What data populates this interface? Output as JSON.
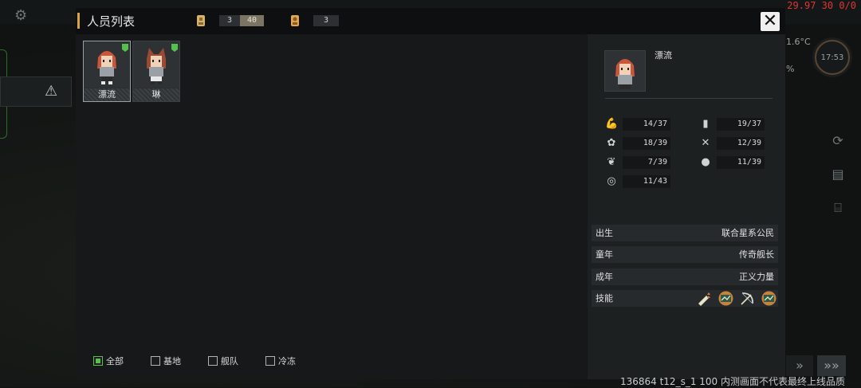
{
  "background": {
    "top_right_stats": "29.97 30 0/0",
    "temperature": "1.6°C",
    "percent_fragment": "%",
    "clock": "17:53",
    "footer_text": "136864 t12_s_1 100 内测画面不代表最终上线品质"
  },
  "dialog": {
    "title": "人员列表",
    "resources": [
      {
        "icon": "crew-capacity-icon",
        "current": "3",
        "max": "40"
      },
      {
        "icon": "crew-count-icon",
        "value": "3"
      }
    ],
    "close_label": "✕"
  },
  "crew_list": [
    {
      "name": "漂流",
      "selected": true
    },
    {
      "name": "琳",
      "selected": false
    }
  ],
  "filters": [
    {
      "label": "全部",
      "checked": true
    },
    {
      "label": "基地",
      "checked": false
    },
    {
      "label": "舰队",
      "checked": false
    },
    {
      "label": "冷冻",
      "checked": false
    }
  ],
  "detail": {
    "name": "漂流",
    "stats": [
      {
        "icon": "strength-arm-icon",
        "value": "14/37"
      },
      {
        "icon": "document-icon",
        "value": "19/37"
      },
      {
        "icon": "paw-icon",
        "value": "18/39"
      },
      {
        "icon": "tools-icon",
        "value": "12/39"
      },
      {
        "icon": "leaf-icon",
        "value": "7/39"
      },
      {
        "icon": "chat-icon",
        "value": "11/39"
      },
      {
        "icon": "target-icon",
        "value": "11/43"
      }
    ],
    "info": [
      {
        "label": "出生",
        "value": "联合星系公民"
      },
      {
        "label": "童年",
        "value": "传奇舰长"
      },
      {
        "label": "成年",
        "value": "正义力量"
      }
    ],
    "skills_label": "技能",
    "skills": [
      "blade-upgrade-icon",
      "map-badge-icon",
      "bow-icon",
      "map-badge-icon"
    ]
  },
  "colors": {
    "accent_gold": "#d9a441",
    "flag_green": "#54c24a",
    "checkbox_green": "#5bbf4e"
  }
}
